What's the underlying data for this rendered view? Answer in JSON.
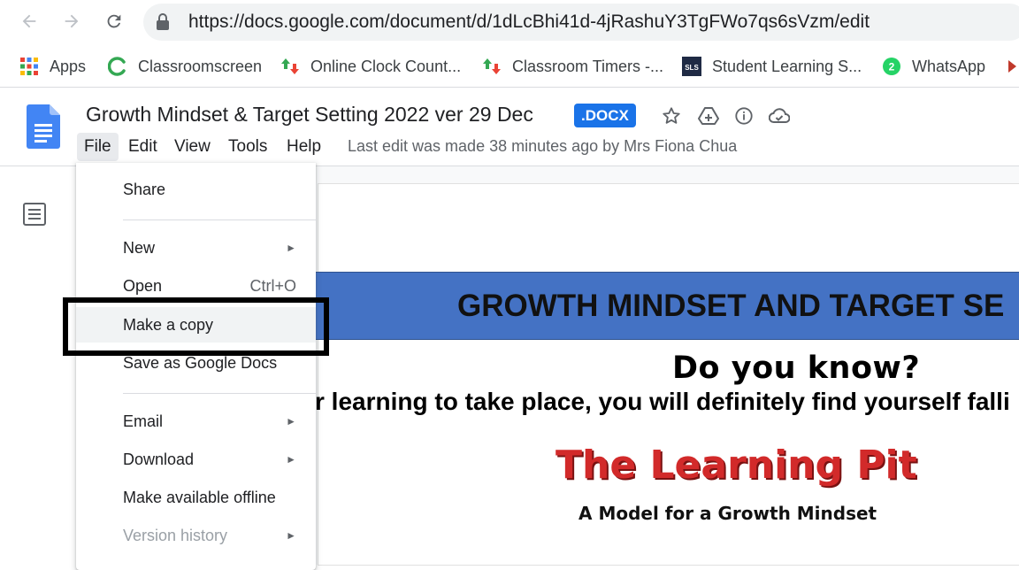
{
  "browser": {
    "url": "https://docs.google.com/document/d/1dLcBhi41d-4jRashuY3TgFWo7qs6sVzm/edit",
    "bookmarks": [
      {
        "label": "Apps",
        "icon": "apps-grid-icon"
      },
      {
        "label": "Classroomscreen",
        "icon": "classroomscreen-icon"
      },
      {
        "label": "Online Clock Count...",
        "icon": "up-down-arrows-icon"
      },
      {
        "label": "Classroom Timers -...",
        "icon": "up-down-arrows-icon"
      },
      {
        "label": "Student Learning S...",
        "icon": "sls-icon"
      },
      {
        "label": "WhatsApp",
        "icon": "whatsapp-icon"
      }
    ]
  },
  "doc": {
    "title": "Growth Mindset & Target Setting 2022 ver 29 Dec",
    "badge": ".DOCX",
    "last_edit": "Last edit was made 38 minutes ago by Mrs Fiona Chua",
    "menus": [
      "File",
      "Edit",
      "View",
      "Tools",
      "Help"
    ]
  },
  "file_menu": {
    "share": "Share",
    "new": "New",
    "open": "Open",
    "open_shortcut": "Ctrl+O",
    "make_copy": "Make a copy",
    "save_as_docs": "Save as Google Docs",
    "email": "Email",
    "download": "Download",
    "offline": "Make available offline",
    "version_history": "Version history",
    "submenu_arrow": "►"
  },
  "content": {
    "banner": "GROWTH MINDSET AND TARGET SE",
    "heading": "Do you know?",
    "body_line": "r learning to take place, you will definitely find yourself falli",
    "pit_title": "The Learning Pit",
    "pit_subtitle": "A Model for a Growth Mindset"
  },
  "colors": {
    "docs_blue": "#4285f4",
    "badge_blue": "#1a73e8",
    "banner_blue": "#4472c4",
    "pit_red": "#d22a2a"
  }
}
